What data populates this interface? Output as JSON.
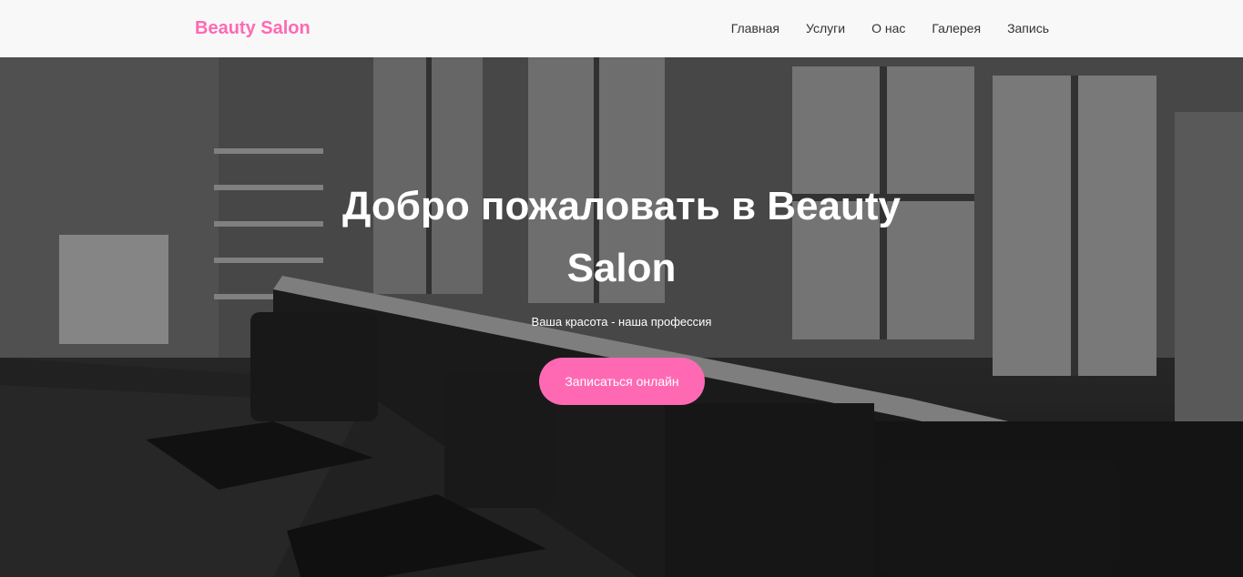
{
  "brand": {
    "name": "Beauty Salon",
    "accent_color": "#ff69b4"
  },
  "nav": {
    "items": [
      {
        "label": "Главная"
      },
      {
        "label": "Услуги"
      },
      {
        "label": "О нас"
      },
      {
        "label": "Галерея"
      },
      {
        "label": "Запись"
      }
    ]
  },
  "hero": {
    "title": "Добро пожаловать в Beauty Salon",
    "subtitle": "Ваша красота - наша профессия",
    "cta_label": "Записаться онлайн",
    "background": "salon-interior-photo"
  }
}
